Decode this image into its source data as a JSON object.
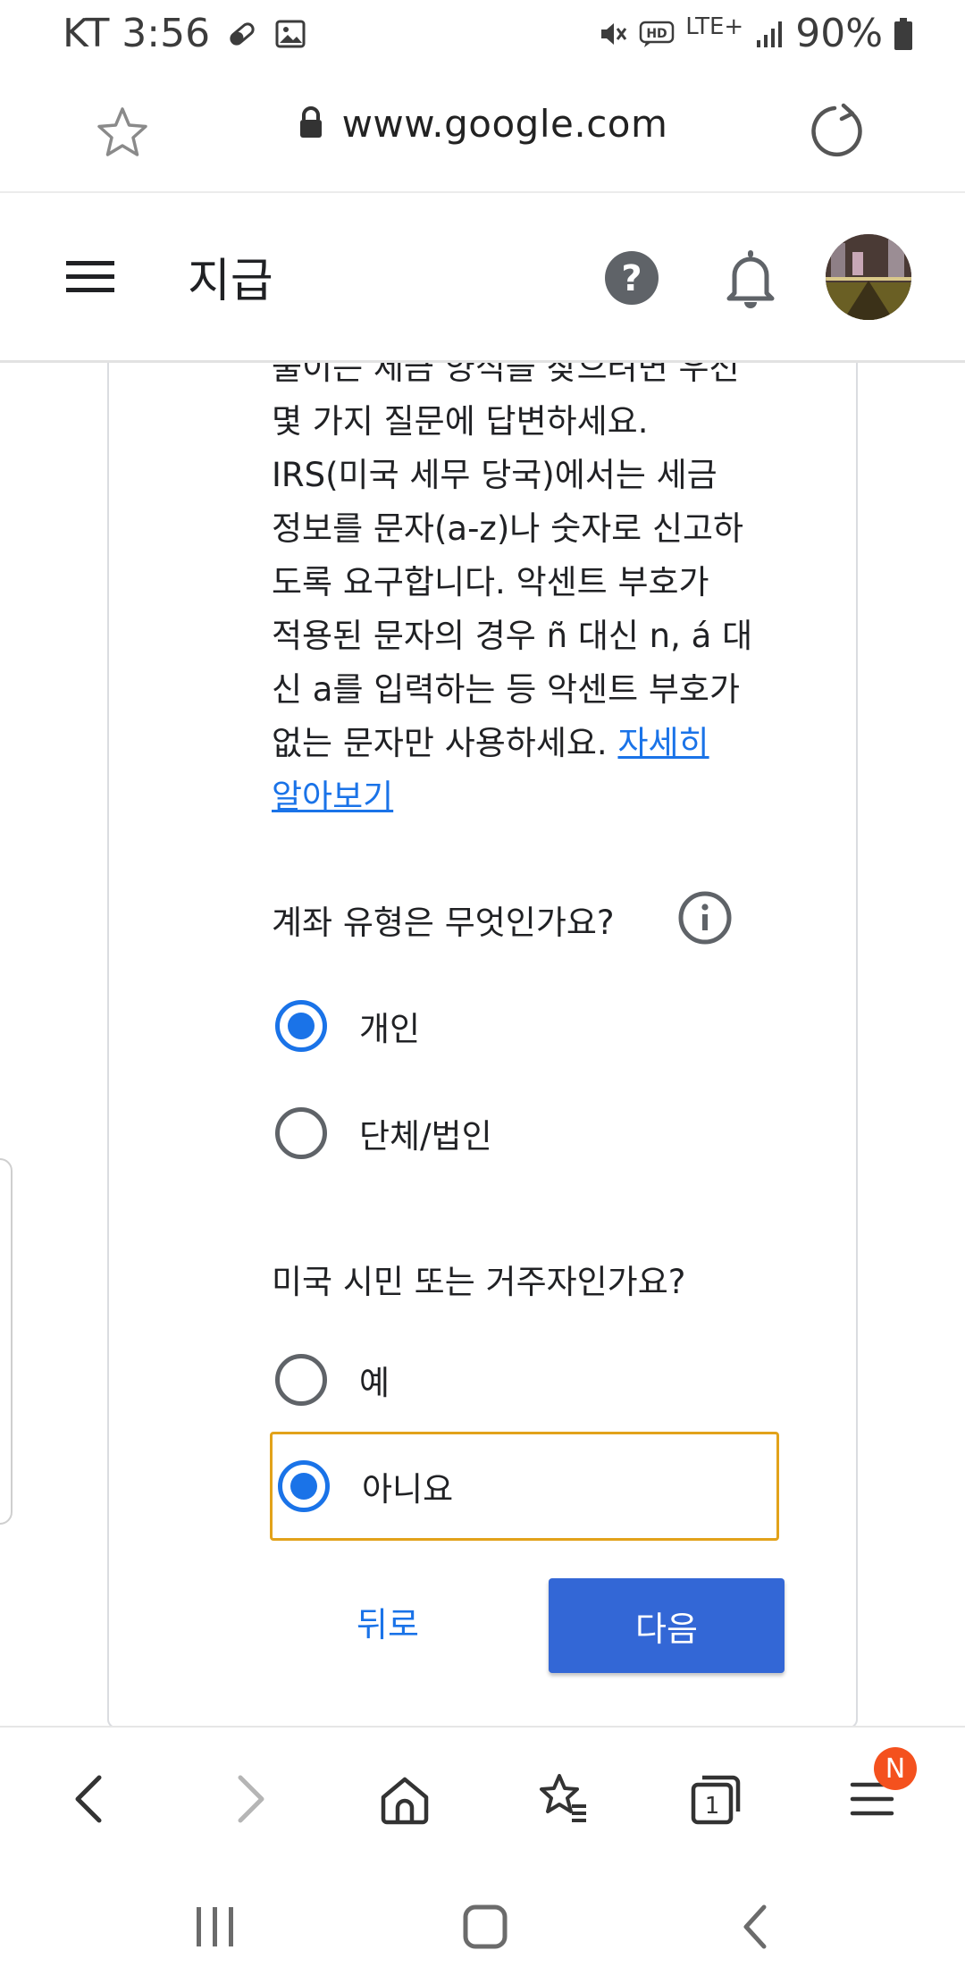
{
  "status_bar": {
    "carrier_time": "KT 3:56",
    "network": "LTE+",
    "battery": "90%",
    "icons": [
      "pill-icon",
      "image-icon",
      "mute-icon",
      "hd-icon",
      "signal-icon",
      "battery-icon"
    ]
  },
  "browser": {
    "url": "www.google.com",
    "tab_count": "1",
    "menu_badge": "N"
  },
  "header": {
    "title": "지급"
  },
  "form": {
    "description_lines": [
      "풀이는 세금 양식을 찾으려면 우선",
      "몇 가지 질문에 답변하세요.",
      "IRS(미국 세무 당국)에서는 세금",
      "정보를 문자(a-z)나 숫자로 신고하",
      "도록 요구합니다. 악센트 부호가",
      "적용된 문자의 경우 ñ 대신 n, á 대",
      "신 a를 입력하는 등 악센트 부호가",
      "없는 문자만 사용하세요. "
    ],
    "learn_more_line1": "자세히",
    "learn_more_line2": "알아보기",
    "account_question": "계좌 유형은 무엇인가요?",
    "account_options": [
      {
        "label": "개인",
        "checked": true
      },
      {
        "label": "단체/법인",
        "checked": false
      }
    ],
    "citizen_question": "미국 시민 또는 거주자인가요?",
    "citizen_options": [
      {
        "label": "예",
        "checked": false
      },
      {
        "label": "아니요",
        "checked": true
      }
    ],
    "back_label": "뒤로",
    "next_label": "다음"
  },
  "colors": {
    "accent": "#1a73e8",
    "next_button": "#3367d6",
    "focus_ring": "#e2a21a",
    "badge": "#f4511e"
  }
}
